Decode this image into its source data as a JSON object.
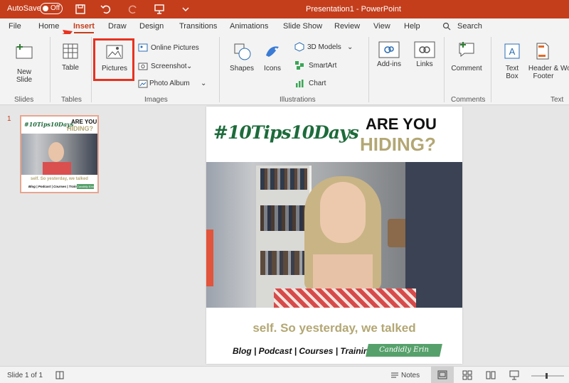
{
  "titlebar": {
    "autosave_label": "AutoSave",
    "autosave_state": "Off",
    "document_title": "Presentation1  -  PowerPoint"
  },
  "tabs": [
    "File",
    "Home",
    "Insert",
    "Draw",
    "Design",
    "Transitions",
    "Animations",
    "Slide Show",
    "Review",
    "View",
    "Help"
  ],
  "search_label": "Search",
  "ribbon": {
    "new_slide": "New Slide",
    "slides_group": "Slides",
    "table": "Table",
    "tables_group": "Tables",
    "pictures": "Pictures",
    "online_pictures": "Online Pictures",
    "screenshot": "Screenshot",
    "photo_album": "Photo Album",
    "images_group": "Images",
    "shapes": "Shapes",
    "icons": "Icons",
    "models_3d": "3D Models",
    "smartart": "SmartArt",
    "chart": "Chart",
    "illustrations_group": "Illustrations",
    "addins": "Add-ins",
    "links": "Links",
    "comment": "Comment",
    "comments_group": "Comments",
    "text_box": "Text Box",
    "header_footer": "Header & Footer",
    "wordart": "Wo",
    "text_group": "Text"
  },
  "thumbnail": {
    "number": "1",
    "hashtag": "#10Tips10Days",
    "are_you": "ARE YOU",
    "hiding": "HIDING?",
    "caption": "self. So yesterday, we talked",
    "links": "Blog | Podcast | Courses | Training",
    "brand": "Candidly Erin"
  },
  "slide": {
    "hashtag": "#10Tips10Days",
    "are_you": "ARE YOU",
    "hiding": "HIDING?",
    "caption": "self. So yesterday, we talked",
    "links": "Blog | Podcast | Courses | Training",
    "brand": "Candidly Erin"
  },
  "statusbar": {
    "slide_count": "Slide 1 of 1",
    "notes": "Notes"
  }
}
